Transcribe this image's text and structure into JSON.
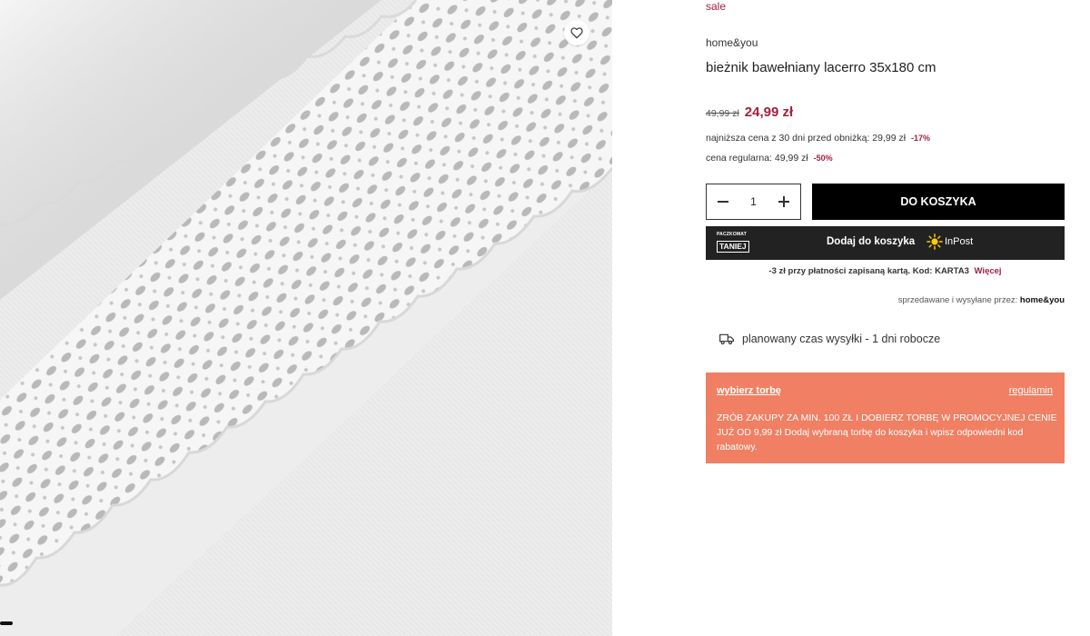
{
  "product": {
    "sale_label": "sale",
    "brand": "home&you",
    "title": "bieżnik bawełniany lacerro 35x180 cm",
    "old_price": "49,99 zł",
    "new_price": "24,99 zł",
    "lowest_price_label": "najniższa cena z 30 dni przed obniżką: 29,99 zł",
    "lowest_price_discount": "-17%",
    "regular_price_label": "cena regularna: 49,99 zł",
    "regular_price_discount": "-50%"
  },
  "cart": {
    "quantity": "1",
    "add_to_cart_label": "DO KOSZYKA"
  },
  "inpost": {
    "badge_top": "PACZKOMAT",
    "badge_bottom": "TANIEJ",
    "label": "Dodaj do koszyka",
    "brand": "InPost"
  },
  "promo": {
    "text": "-3 zł przy płatności zapisaną kartą. Kod: KARTA3",
    "more_label": "Więcej"
  },
  "seller": {
    "label": "sprzedawane i wysyłane przez:",
    "name": "home&you"
  },
  "shipping": {
    "text": "planowany czas wysyłki - 1 dni robocze",
    "icon": "truck-icon"
  },
  "bag": {
    "choose_label": "wybierz torbę",
    "rules_label": "regulamin",
    "description": "ZRÓB ZAKUPY ZA MIN. 100 ZŁ I DOBIERZ TORBĘ W PROMOCYJNEJ CENIE JUŻ OD 9,99 zł Dodaj wybraną torbę do koszyka i wpisz odpowiedni kod rabatowy."
  },
  "colors": {
    "accent": "#a3213f",
    "bag_background": "#f07f63",
    "button_black": "#000000",
    "inpost_background": "#222222",
    "inpost_yellow": "#ffcb05"
  }
}
